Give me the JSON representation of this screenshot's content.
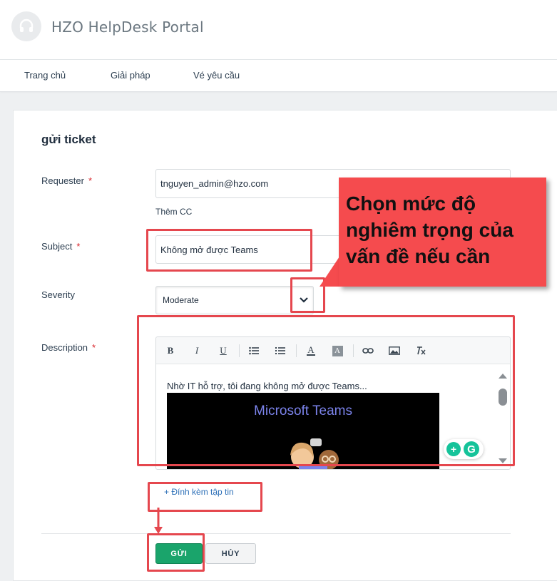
{
  "header": {
    "portal_title": "HZO HelpDesk Portal",
    "logo_icon": "headset-icon"
  },
  "nav": {
    "items": [
      {
        "label": "Trang chủ"
      },
      {
        "label": "Giải pháp"
      },
      {
        "label": "Vé yêu cầu"
      }
    ]
  },
  "form": {
    "title": "gửi ticket",
    "required_mark": "*",
    "requester": {
      "label": "Requester",
      "value": "tnguyen_admin@hzo.com"
    },
    "add_cc": "Thêm CC",
    "subject": {
      "label": "Subject",
      "value": "Không mở được Teams"
    },
    "severity": {
      "label": "Severity",
      "value": "Moderate"
    },
    "description": {
      "label": "Description",
      "text": "Nhờ IT hỗ trợ, tôi đang không mở được Teams...",
      "image_title": "Microsoft Teams"
    },
    "toolbar": {
      "bold": "B",
      "italic": "I",
      "underline": "U",
      "text_color": "A",
      "bg_color": "A"
    },
    "attach_label": "+ Đính kèm tập tin",
    "submit_label": "GỬI",
    "cancel_label": "HỦY"
  },
  "annotation": {
    "callout_text": "Chọn mức độ nghiêm trọng của vấn đề nếu cần",
    "highlight_color": "#e5474e",
    "callout_color": "#f54b4e"
  },
  "colors": {
    "submit": "#1aa46b",
    "link": "#2c6fb7",
    "required": "#d9262c"
  }
}
